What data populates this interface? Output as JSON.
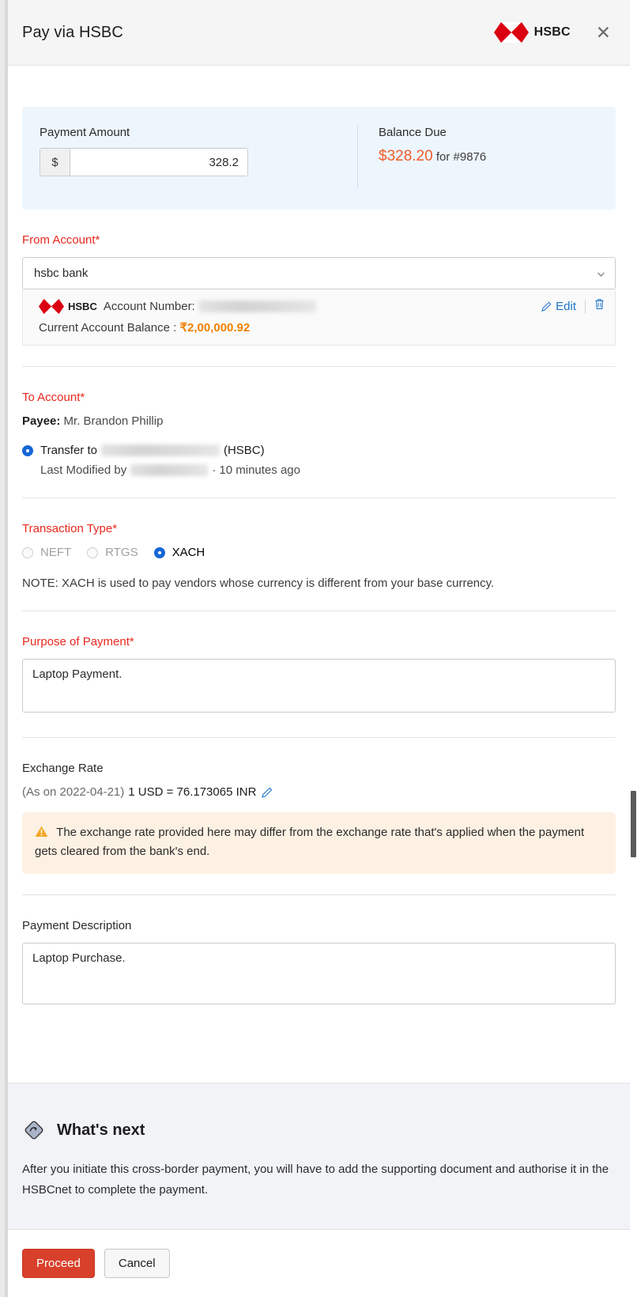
{
  "header": {
    "title": "Pay via HSBC",
    "brand_word": "HSBC",
    "close_label": "✕"
  },
  "amount_panel": {
    "payment_amount_label": "Payment Amount",
    "currency_symbol": "$",
    "amount_value": "328.2",
    "amount_placeholder": "0.00",
    "balance_due_label": "Balance Due",
    "balance_due_amount": "$328.20",
    "balance_due_suffix": " for #9876"
  },
  "from_account": {
    "label": "From Account*",
    "selected_bank": "hsbc bank",
    "brand_word": "HSBC",
    "account_number_label": "Account Number:",
    "account_number_value": "",
    "edit_label": "Edit",
    "balance_label": "Current Account Balance",
    "balance_separator": " : ",
    "balance_value": "₹2,00,000.92"
  },
  "to_account": {
    "label": "To Account*",
    "payee_prefix": "Payee:",
    "payee_name": "Mr. Brandon Phillip",
    "transfer_to_prefix": "Transfer to",
    "transfer_to_suffix": "(HSBC)",
    "last_modified_prefix": "Last Modified by",
    "last_modified_suffix": "· 10 minutes ago"
  },
  "transaction_type": {
    "label": "Transaction Type*",
    "options": [
      {
        "label": "NEFT",
        "selected": false,
        "disabled": true
      },
      {
        "label": "RTGS",
        "selected": false,
        "disabled": true
      },
      {
        "label": "XACH",
        "selected": true,
        "disabled": false
      }
    ],
    "note": "NOTE: XACH is used to pay vendors whose currency is different from your base currency."
  },
  "purpose_of_payment": {
    "label": "Purpose of Payment*",
    "value": "Laptop Payment.",
    "placeholder": ""
  },
  "exchange_rate": {
    "label": "Exchange Rate",
    "as_on": "(As on 2022-04-21)",
    "rate_text": "1 USD = 76.173065 INR",
    "warning": "The exchange rate provided here may differ from the exchange rate that's applied when the payment gets cleared from the bank's end."
  },
  "payment_description": {
    "label": "Payment Description",
    "value": "Laptop Purchase.",
    "placeholder": ""
  },
  "whats_next": {
    "title": "What's next",
    "body": "After you initiate this cross-border payment, you will have to add the supporting document and authorise it in the HSBCnet to complete the payment."
  },
  "footer": {
    "proceed_label": "Proceed",
    "cancel_label": "Cancel"
  },
  "colors": {
    "hsbc_red": "#db0011",
    "required_red": "#e8291e",
    "orange_amount": "#f05a28",
    "inr_orange": "#f08000",
    "link_blue": "#1a73c8",
    "radio_blue": "#1667d6",
    "proceed_red": "#d9402b",
    "panel_blue": "#eef6fd",
    "warn_bg": "#fdf1e3",
    "whats_next_bg": "#f1f3f7"
  }
}
